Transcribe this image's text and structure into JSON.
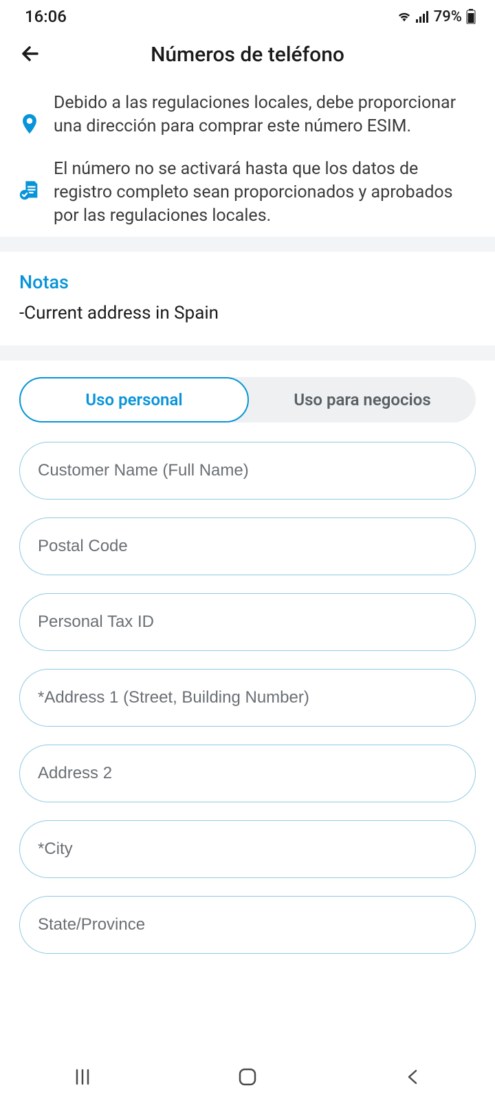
{
  "status": {
    "time": "16:06",
    "battery": "79%"
  },
  "header": {
    "title": "Números de teléfono"
  },
  "info": [
    "Debido a las regulaciones locales, debe proporcionar una dirección para comprar este número ESIM.",
    "El número no se activará hasta que los datos de registro completo sean proporcionados y aprobados por las regulaciones locales."
  ],
  "notes": {
    "title": "Notas",
    "items": [
      "-Current address in Spain"
    ]
  },
  "tabs": {
    "personal": "Uso personal",
    "business": "Uso para negocios"
  },
  "fields": {
    "customer_name": "Customer Name (Full Name)",
    "postal_code": "Postal Code",
    "tax_id": "Personal Tax ID",
    "address1": "*Address 1 (Street, Building Number)",
    "address2": "Address 2",
    "city": "*City",
    "state": "State/Province"
  }
}
